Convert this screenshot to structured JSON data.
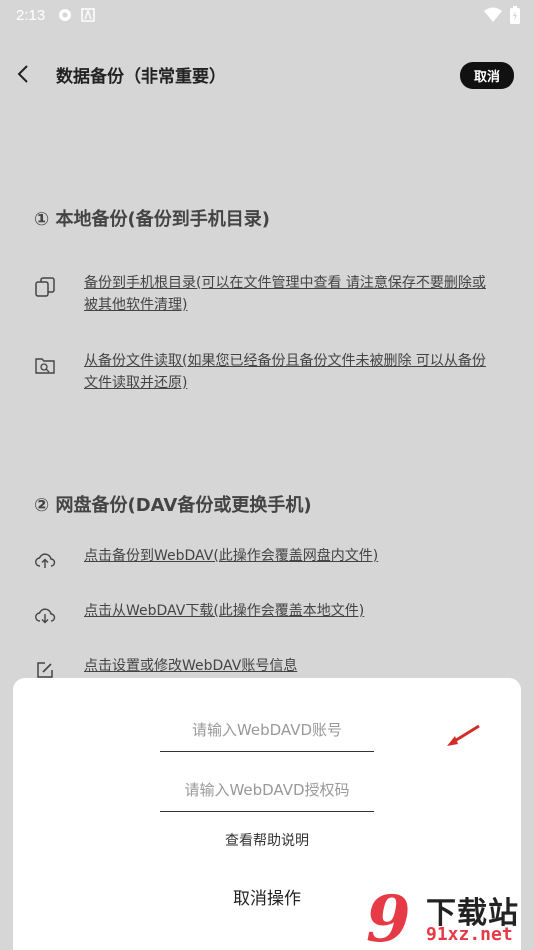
{
  "status_bar": {
    "time": "2:13"
  },
  "header": {
    "title": "数据备份（非常重要）",
    "cancel_label": "取消"
  },
  "local_section": {
    "title": "① 本地备份(备份到手机目录)",
    "items": [
      {
        "label": "备份到手机根目录(可以在文件管理中查看 请注意保存不要删除或被其他软件清理)",
        "icon": "copy-icon"
      },
      {
        "label": "从备份文件读取(如果您已经备份且备份文件未被删除 可以从备份文件读取并还原)",
        "icon": "folder-search-icon"
      }
    ]
  },
  "cloud_section": {
    "title": "② 网盘备份(DAV备份或更换手机)",
    "items": [
      {
        "label": "点击备份到WebDAV(此操作会覆盖网盘内文件)",
        "icon": "cloud-upload-icon"
      },
      {
        "label": "点击从WebDAV下载(此操作会覆盖本地文件)",
        "icon": "cloud-download-icon"
      },
      {
        "label": "点击设置或修改WebDAV账号信息",
        "icon": "edit-icon"
      }
    ]
  },
  "dialog": {
    "account_placeholder": "请输入WebDAVD账号",
    "auth_placeholder": "请输入WebDAVD授权码",
    "help_label": "查看帮助说明",
    "cancel_label": "取消操作"
  },
  "watermark": {
    "digits": "9",
    "brand": "下载站",
    "url": "91xz.net"
  },
  "colors": {
    "background": "#d6d6d6",
    "sheet": "#ffffff",
    "accent_red": "#e63a46",
    "pill": "#111111"
  }
}
